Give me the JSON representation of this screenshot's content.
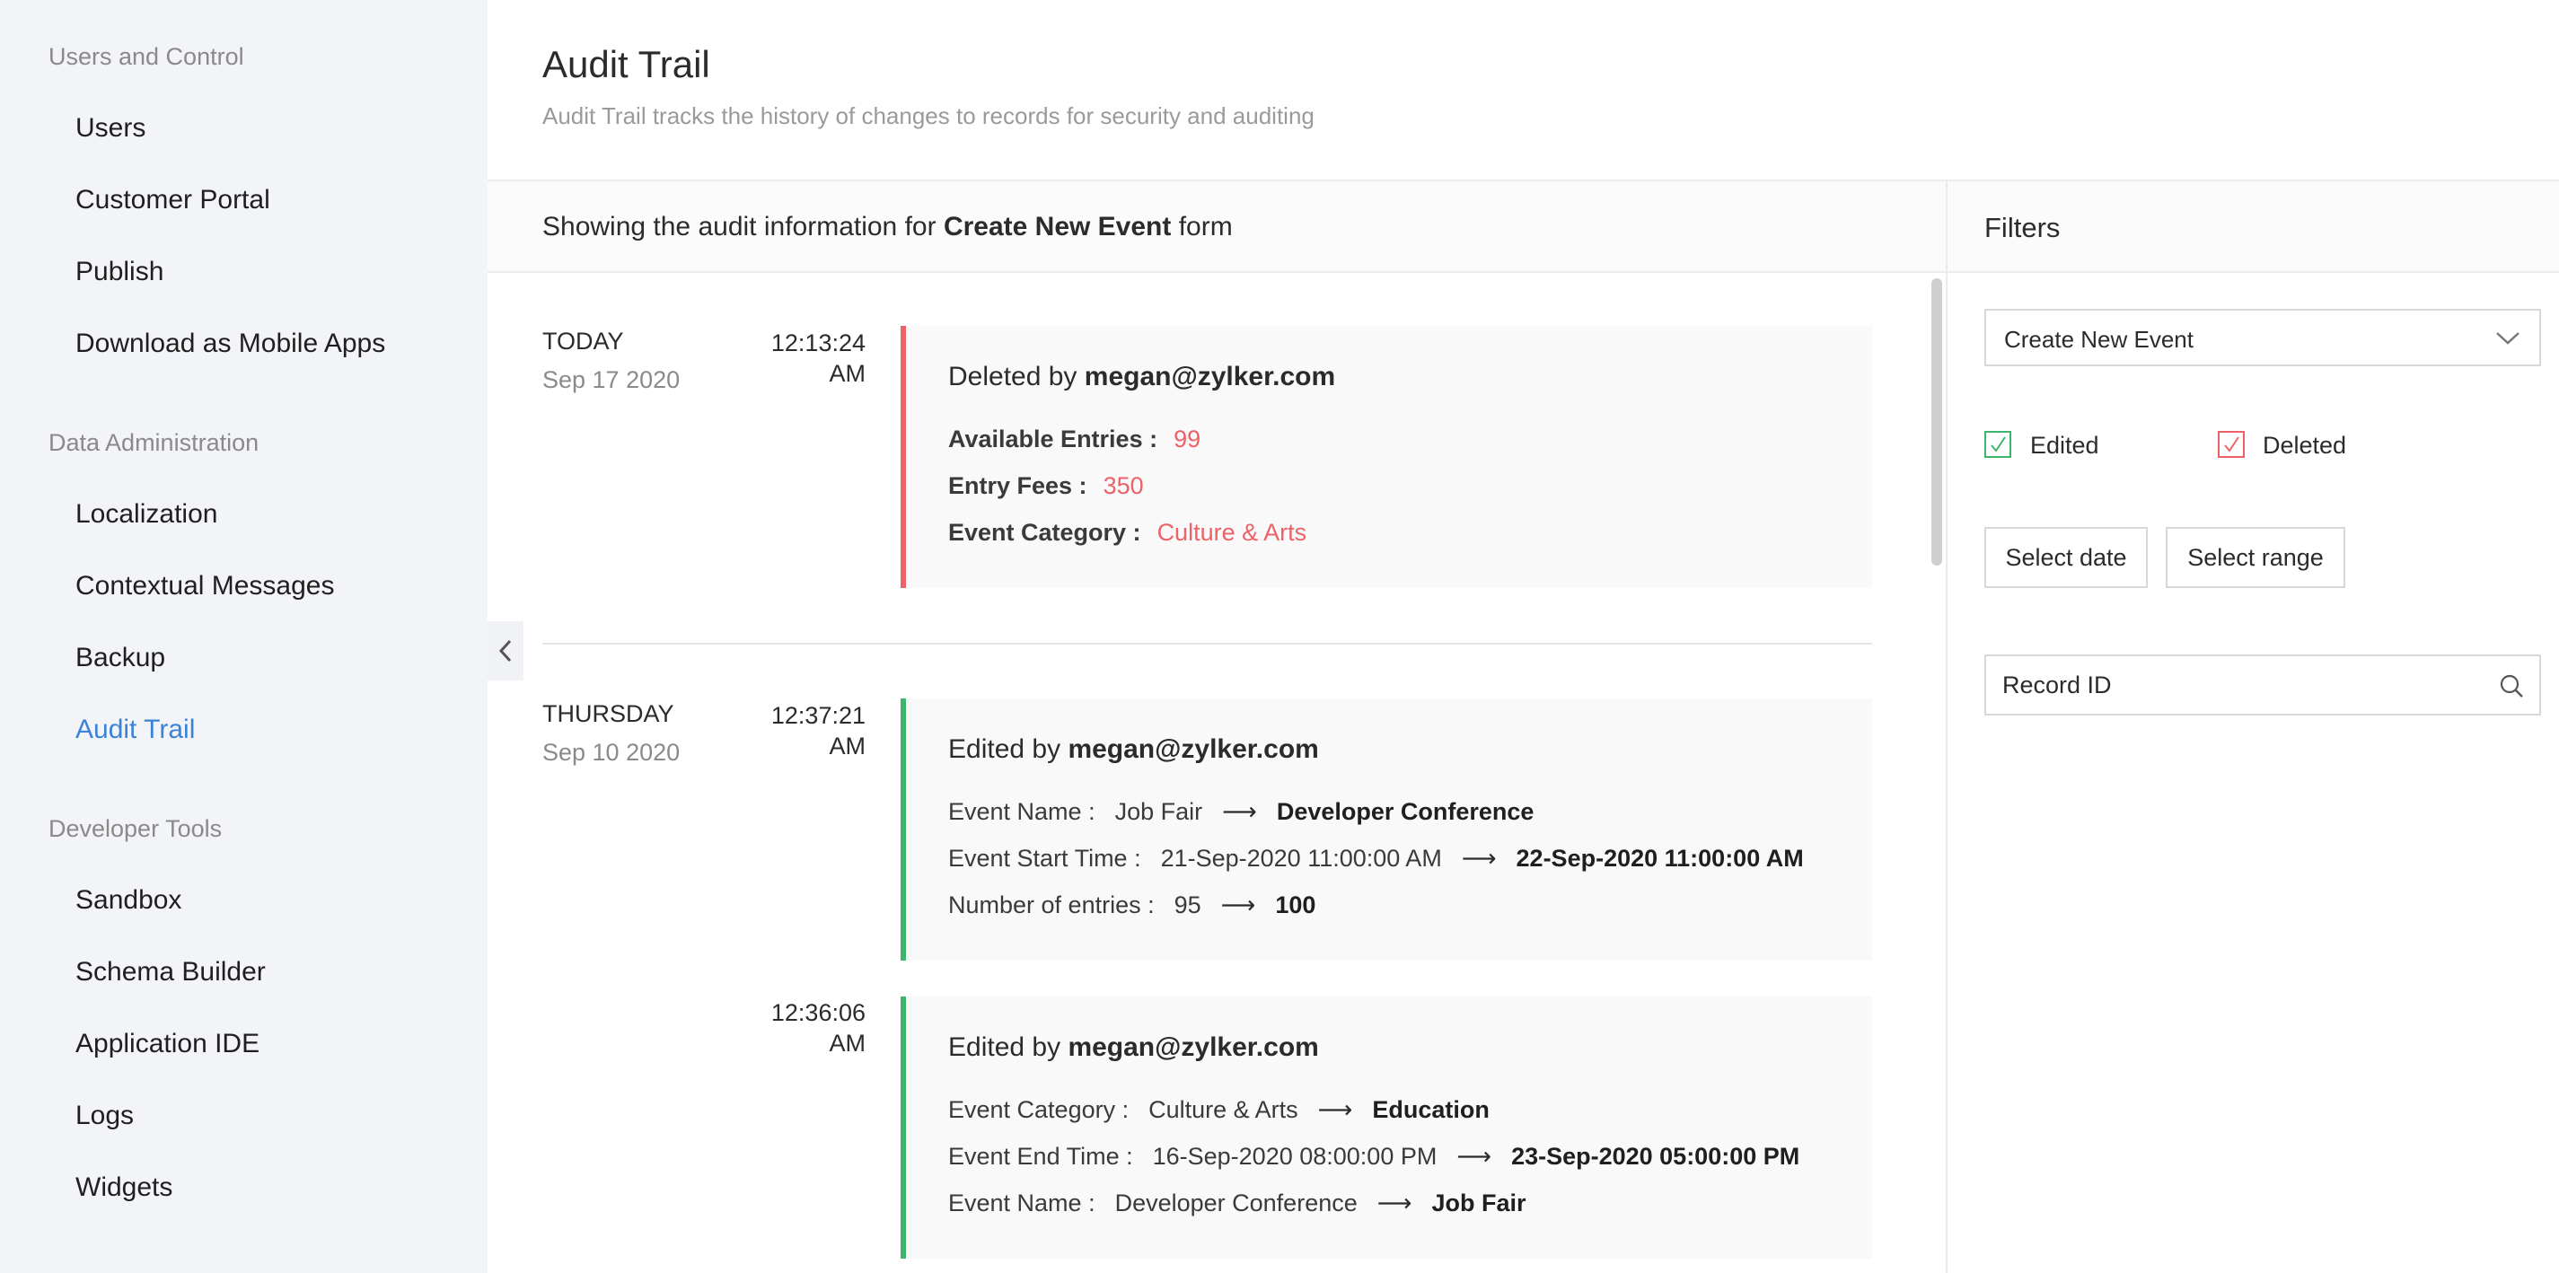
{
  "sidebar": {
    "sections": [
      {
        "title": "Users and Control",
        "items": [
          "Users",
          "Customer Portal",
          "Publish",
          "Download as Mobile Apps"
        ]
      },
      {
        "title": "Data Administration",
        "items": [
          "Localization",
          "Contextual Messages",
          "Backup",
          "Audit Trail"
        ]
      },
      {
        "title": "Developer Tools",
        "items": [
          "Sandbox",
          "Schema Builder",
          "Application IDE",
          "Logs",
          "Widgets"
        ]
      }
    ],
    "active_item": "Audit Trail"
  },
  "header": {
    "title": "Audit Trail",
    "subtitle": "Audit Trail tracks the history of changes to records for security and auditing"
  },
  "info_bar": {
    "prefix": "Showing the audit information for",
    "form_name": "Create New Event",
    "suffix": "form"
  },
  "timeline": {
    "groups": [
      {
        "day": "TODAY",
        "date": "Sep 17 2020",
        "entries": [
          {
            "time_line1": "12:13:24",
            "time_line2": "AM",
            "action": "Deleted by",
            "user": "megan@zylker.com",
            "fields": [
              {
                "label": "Available Entries :",
                "value": "99"
              },
              {
                "label": "Entry Fees :",
                "value": "350"
              },
              {
                "label": "Event Category :",
                "value": "Culture & Arts"
              }
            ]
          }
        ]
      },
      {
        "day": "THURSDAY",
        "date": "Sep 10 2020",
        "entries": [
          {
            "time_line1": "12:37:21",
            "time_line2": "AM",
            "action": "Edited by",
            "user": "megan@zylker.com",
            "changes": [
              {
                "label": "Event Name :",
                "old": "Job Fair",
                "new": "Developer Conference"
              },
              {
                "label": "Event Start Time :",
                "old": "21-Sep-2020 11:00:00 AM",
                "new": "22-Sep-2020 11:00:00 AM"
              },
              {
                "label": "Number of entries :",
                "old": "95",
                "new": "100"
              }
            ]
          },
          {
            "time_line1": "12:36:06",
            "time_line2": "AM",
            "action": "Edited by",
            "user": "megan@zylker.com",
            "changes": [
              {
                "label": "Event Category :",
                "old": "Culture & Arts",
                "new": "Education"
              },
              {
                "label": "Event End Time :",
                "old": "16-Sep-2020 08:00:00 PM",
                "new": "23-Sep-2020 05:00:00 PM"
              },
              {
                "label": "Event Name :",
                "old": "Developer Conference",
                "new": "Job Fair"
              }
            ]
          }
        ]
      }
    ],
    "arrow": "⟶"
  },
  "filters": {
    "title": "Filters",
    "form_select": "Create New Event",
    "edited_label": "Edited",
    "deleted_label": "Deleted",
    "select_date_label": "Select date",
    "select_range_label": "Select range",
    "record_id_placeholder": "Record ID"
  },
  "colors": {
    "accent": "#3b82d9",
    "deleted": "#ec6266",
    "edited": "#3bb56a"
  },
  "icons": {
    "collapse": "chevron-left-icon",
    "dropdown": "chevron-down-icon",
    "search": "search-icon",
    "check": "check-icon"
  }
}
